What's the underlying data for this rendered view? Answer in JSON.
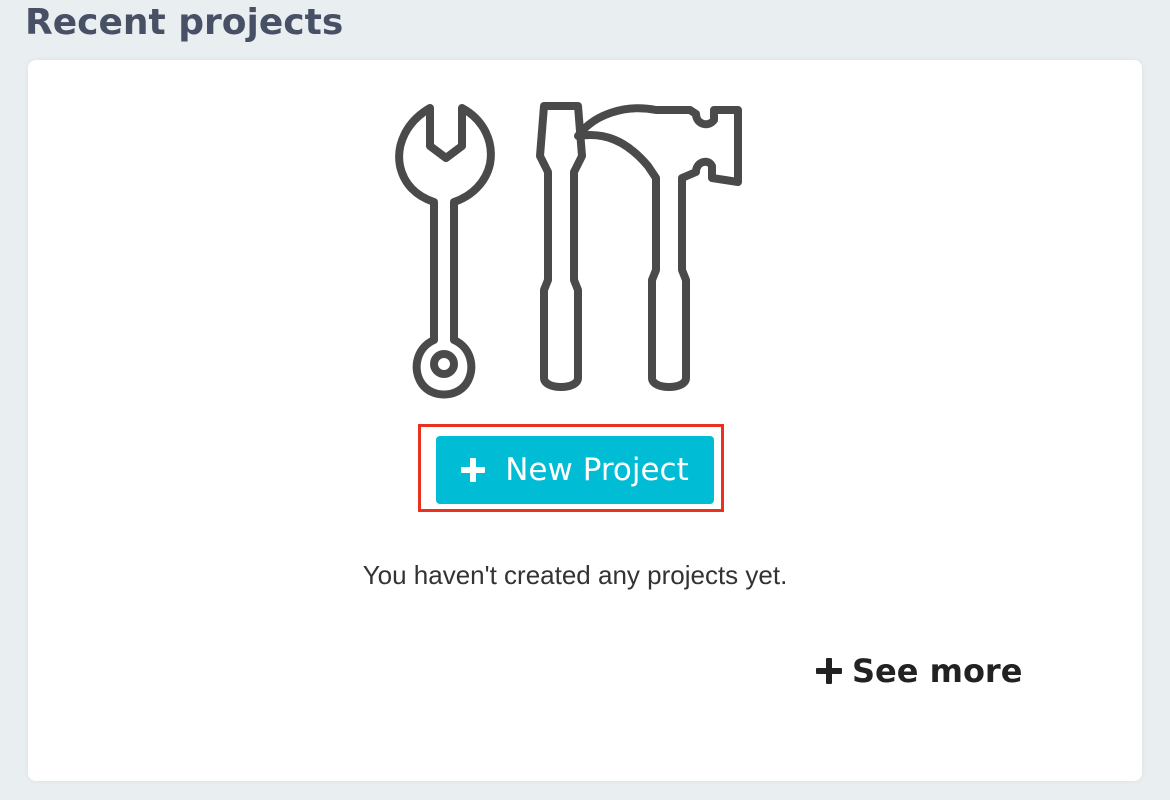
{
  "section": {
    "title": "Recent projects"
  },
  "card": {
    "illustration_icon": "tools-icon",
    "new_project_button": {
      "label": "New Project",
      "icon": "plus-icon",
      "color": "#00bcd4",
      "highlight_color": "#e8321f"
    },
    "empty_message": "You haven't created any projects yet.",
    "see_more": {
      "label": "See more",
      "icon": "plus-icon"
    }
  }
}
